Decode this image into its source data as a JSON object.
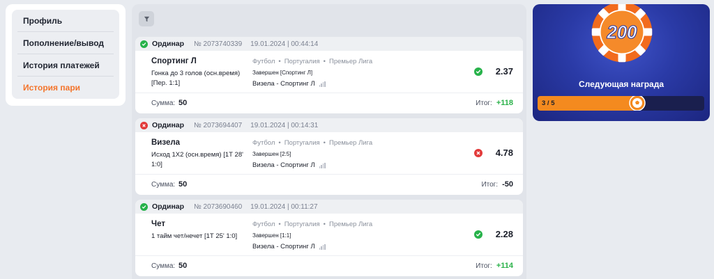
{
  "menu": {
    "items": [
      {
        "label": "Профиль",
        "active": false
      },
      {
        "label": "Пополнение/вывод",
        "active": false
      },
      {
        "label": "История платежей",
        "active": false
      },
      {
        "label": "История пари",
        "active": true
      }
    ]
  },
  "bets": [
    {
      "status": "win",
      "type": "Ординар",
      "number": "№ 2073740339",
      "datetime": "19.01.2024 | 00:44:14",
      "selection": "Спортинг Л",
      "description": "Гонка до 3 голов (осн.время) [Пер. 1:1]",
      "sport": "Футбол",
      "country": "Португалия",
      "league": "Премьер Лига",
      "state": "Завершен [Спортинг Л]",
      "match": "Визела - Спортинг Л",
      "odds": "2.37",
      "sum_label": "Сумма:",
      "sum": "50",
      "result_label": "Итог:",
      "result": "+118"
    },
    {
      "status": "lose",
      "type": "Ординар",
      "number": "№ 2073694407",
      "datetime": "19.01.2024 | 00:14:31",
      "selection": "Визела",
      "description": "Исход 1X2 (осн.время) [1Т 28' 1:0]",
      "sport": "Футбол",
      "country": "Португалия",
      "league": "Премьер Лига",
      "state": "Завершен [2:5]",
      "match": "Визела - Спортинг Л",
      "odds": "4.78",
      "sum_label": "Сумма:",
      "sum": "50",
      "result_label": "Итог:",
      "result": "-50"
    },
    {
      "status": "win",
      "type": "Ординар",
      "number": "№ 2073690460",
      "datetime": "19.01.2024 | 00:11:27",
      "selection": "Чет",
      "description": "1 тайм чет/нечет [1Т 25' 1:0]",
      "sport": "Футбол",
      "country": "Португалия",
      "league": "Премьер Лига",
      "state": "Завершен [1:1]",
      "match": "Визела - Спортинг Л",
      "odds": "2.28",
      "sum_label": "Сумма:",
      "sum": "50",
      "result_label": "Итог:",
      "result": "+114"
    }
  ],
  "reward": {
    "chip_value": "200",
    "title": "Следующая награда",
    "progress_text": "3 / 5",
    "progress_current": 3,
    "progress_total": 5
  },
  "colors": {
    "accent": "#f4742b",
    "win": "#27b24a",
    "lose": "#e23a3a",
    "reward_bg": "#2a3aa6"
  },
  "icons": {
    "filter": "filter-icon",
    "win": "check-circle-icon",
    "lose": "x-circle-icon",
    "stats": "stats-bars-icon",
    "ball": "soccer-ball-icon",
    "chip": "casino-chip-icon"
  }
}
